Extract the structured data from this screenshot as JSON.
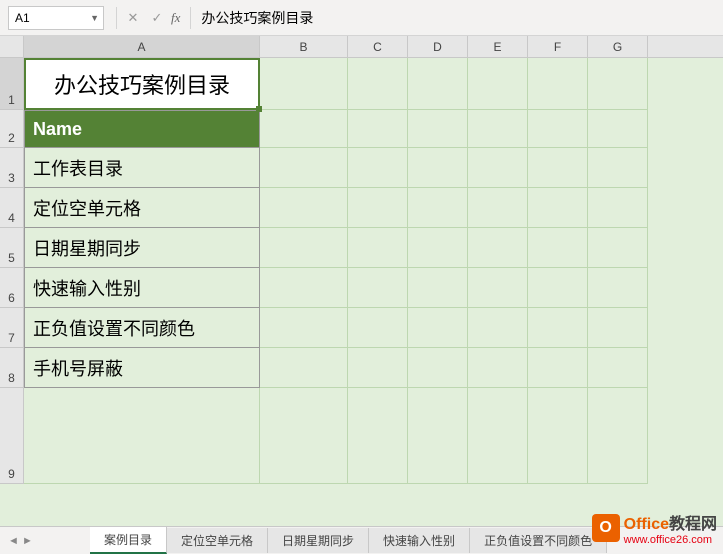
{
  "name_box": "A1",
  "formula_value": "办公技巧案例目录",
  "columns": [
    "A",
    "B",
    "C",
    "D",
    "E",
    "F",
    "G"
  ],
  "rows": [
    "1",
    "2",
    "3",
    "4",
    "5",
    "6",
    "7",
    "8",
    "9"
  ],
  "cells": {
    "a1": "办公技巧案例目录",
    "a2": "Name",
    "list": [
      "工作表目录",
      "定位空单元格",
      "日期星期同步",
      "快速输入性别",
      "正负值设置不同颜色",
      "手机号屏蔽"
    ]
  },
  "sheet_tabs": [
    "案例目录",
    "定位空单元格",
    "日期星期同步",
    "快速输入性别",
    "正负值设置不同颜色"
  ],
  "active_tab": 0,
  "watermark": {
    "brand1": "Office",
    "brand2": "教程网",
    "url": "www.office26.com"
  }
}
